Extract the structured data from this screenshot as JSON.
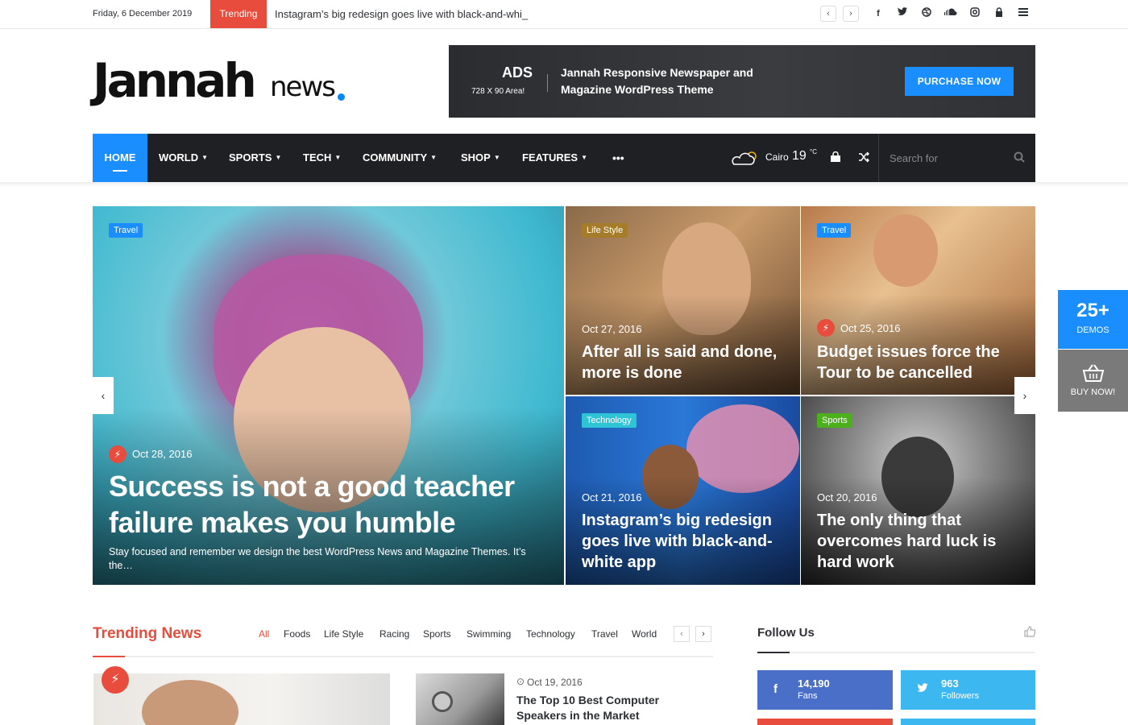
{
  "topbar": {
    "date": "Friday, 6 December 2019",
    "trending_label": "Trending",
    "trending_text": "Instagram’s big redesign goes live with black-and-whi_",
    "social_icons": [
      "facebook-icon",
      "twitter-icon",
      "dribbble-icon",
      "soundcloud-icon",
      "instagram-icon",
      "lock-icon",
      "menu-icon"
    ]
  },
  "header": {
    "logo_main": "Jannah",
    "logo_sub": "news",
    "ad": {
      "heading": "ADS",
      "size_text": "728 X 90 Area!",
      "text": "Jannah Responsive Newspaper and Magazine WordPress Theme",
      "button": "PURCHASE NOW"
    }
  },
  "nav": {
    "items": [
      "HOME",
      "WORLD",
      "SPORTS",
      "TECH",
      "COMMUNITY",
      "SHOP",
      "FEATURES"
    ],
    "more": "•••",
    "weather_city": "Cairo",
    "weather_temp": "19",
    "weather_unit": "°C",
    "search_placeholder": "Search for"
  },
  "hero": {
    "main": {
      "category": "Travel",
      "date": "Oct 28, 2016",
      "title": "Success is not a good teacher failure makes you humble",
      "excerpt": "Stay focused and remember we design the best WordPress News and Magazine Themes. It’s the…"
    },
    "tiles": [
      {
        "category": "Life Style",
        "date": "Oct 27, 2016",
        "title": "After all is said and done, more is done"
      },
      {
        "category": "Travel",
        "date": "Oct 25, 2016",
        "title": "Budget issues force the Tour to be cancelled"
      },
      {
        "category": "Technology",
        "date": "Oct 21, 2016",
        "title": "Instagram’s big redesign goes live with black-and-white app"
      },
      {
        "category": "Sports",
        "date": "Oct 20, 2016",
        "title": "The only thing that overcomes hard luck is hard work"
      }
    ]
  },
  "side_widget": {
    "demos_count": "25+",
    "demos_label": "DEMOS",
    "buy_label": "BUY NOW!"
  },
  "trending": {
    "heading": "Trending News",
    "filters": [
      "All",
      "Foods",
      "Life Style",
      "Racing",
      "Sports",
      "Swimming",
      "Technology",
      "Travel",
      "World"
    ],
    "post": {
      "date": "Oct 19, 2016",
      "title": "The Top 10 Best Computer Speakers in the Market"
    }
  },
  "follow": {
    "heading": "Follow Us",
    "facebook": {
      "count": "14,190",
      "label": "Fans"
    },
    "twitter": {
      "count": "963",
      "label": "Followers"
    }
  },
  "colors": {
    "accent": "#1a8dff",
    "trending": "#e74c3c",
    "nav_bg": "#1f2024"
  }
}
